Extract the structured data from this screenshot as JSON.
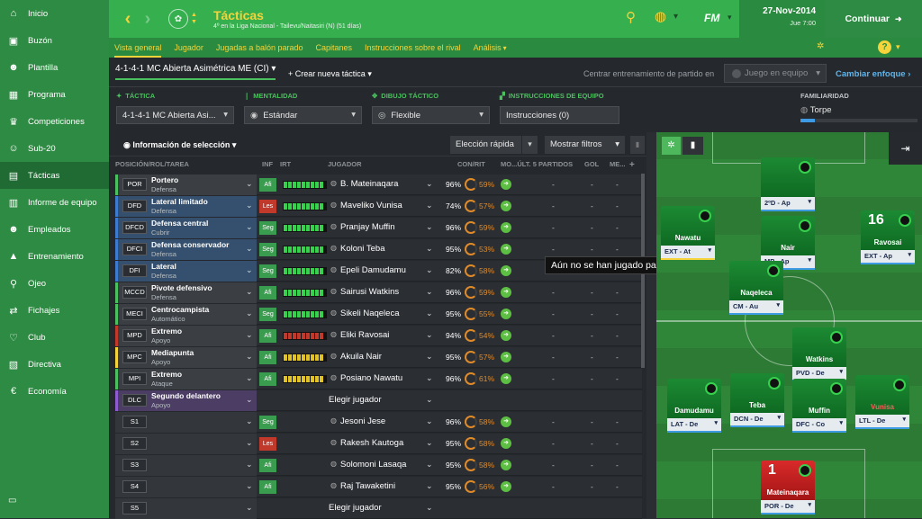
{
  "sidebar": {
    "items": [
      {
        "label": "Inicio",
        "icon": "home-icon"
      },
      {
        "label": "Buzón",
        "icon": "inbox-icon"
      },
      {
        "label": "Plantilla",
        "icon": "squad-icon"
      },
      {
        "label": "Programa",
        "icon": "calendar-icon"
      },
      {
        "label": "Competiciones",
        "icon": "trophy-icon"
      },
      {
        "label": "Sub-20",
        "icon": "youth-icon"
      },
      {
        "label": "Tácticas",
        "icon": "tactics-icon",
        "active": true
      },
      {
        "label": "Informe de equipo",
        "icon": "report-icon"
      },
      {
        "label": "Empleados",
        "icon": "staff-icon"
      },
      {
        "label": "Entrenamiento",
        "icon": "training-icon"
      },
      {
        "label": "Ojeo",
        "icon": "search-icon"
      },
      {
        "label": "Fichajes",
        "icon": "transfer-icon"
      },
      {
        "label": "Club",
        "icon": "club-icon"
      },
      {
        "label": "Directiva",
        "icon": "board-icon"
      },
      {
        "label": "Economía",
        "icon": "finance-icon"
      }
    ]
  },
  "header": {
    "title": "Tácticas",
    "subtitle": "4º en la Liga Nacional - Tailevu/Naitasiri (N) (51 días)",
    "logo_text": "FM",
    "date": "27-Nov-2014",
    "day_time": "Jue 7:00",
    "continue_label": "Continuar"
  },
  "nav": {
    "tabs": [
      "Vista general",
      "Jugador",
      "Jugadas a balón parado",
      "Capitanes",
      "Instrucciones sobre el rival",
      "Análisis"
    ]
  },
  "tactic_bar": {
    "tactic_name": "4-1-4-1 MC Abierta Asimétrica ME (CI)",
    "new_tactic": "Crear nueva táctica",
    "training_label": "Centrar entrenamiento de partido en",
    "training_value": "Juego en equipo",
    "change_focus": "Cambiar enfoque"
  },
  "settings": {
    "tactic_label": "TÁCTICA",
    "tactic_value": "4-1-4-1 MC Abierta Asi...",
    "mentality_label": "MENTALIDAD",
    "mentality_value": "Estándar",
    "shape_label": "DIBUJO TÁCTICO",
    "shape_value": "Flexible",
    "instructions_label": "INSTRUCCIONES DE EQUIPO",
    "instructions_value": "Instrucciones (0)",
    "familiarity_label": "FAMILIARIDAD",
    "familiarity_value": "Torpe",
    "familiarity_level": 0.12
  },
  "list": {
    "selection_info": "Información de selección",
    "quick_pick": "Elección rápida",
    "filters": "Mostrar filtros",
    "columns": {
      "pos": "POSICIÓN/ROL/TAREA",
      "inf": "INF",
      "irt": "IRT",
      "player": "JUGADOR",
      "cond": "CON/RIT",
      "mo": "MO...ÚLT. 5 PARTIDOS",
      "gol": "GOL",
      "me": "ME..."
    },
    "rows": [
      {
        "pos": "POR",
        "role": "Portero",
        "duty": "Defensa",
        "inf": "Afi",
        "player": "B. Mateinaqara",
        "cond": "96%",
        "rit": "59%",
        "stripe": "#4ac05f",
        "inf_color": "#3a9c4e",
        "irt_color": "#37d14e"
      },
      {
        "pos": "DFD",
        "role": "Lateral limitado",
        "duty": "Defensa",
        "inf": "Les",
        "player": "Maveliko Vunisa",
        "cond": "74%",
        "rit": "57%",
        "stripe": "#3d7bd1",
        "inf_color": "#c0392b",
        "irt_color": "#37d14e"
      },
      {
        "pos": "DFCD",
        "role": "Defensa central",
        "duty": "Cubrir",
        "inf": "Seg",
        "player": "Pranjay Muffin",
        "cond": "96%",
        "rit": "59%",
        "stripe": "#3d7bd1",
        "inf_color": "#3a9c4e",
        "irt_color": "#37d14e"
      },
      {
        "pos": "DFCI",
        "role": "Defensa conservador",
        "duty": "Defensa",
        "inf": "Seg",
        "player": "Koloni Teba",
        "cond": "95%",
        "rit": "53%",
        "stripe": "#3d7bd1",
        "inf_color": "#3a9c4e",
        "irt_color": "#37d14e"
      },
      {
        "pos": "DFI",
        "role": "Lateral",
        "duty": "Defensa",
        "inf": "Seg",
        "player": "Epeli Damudamu",
        "cond": "82%",
        "rit": "58%",
        "stripe": "#3d7bd1",
        "inf_color": "#3a9c4e",
        "irt_color": "#37d14e"
      },
      {
        "pos": "MCCD",
        "role": "Pivote defensivo",
        "duty": "Defensa",
        "inf": "Afi",
        "player": "Sairusi Watkins",
        "cond": "96%",
        "rit": "59%",
        "stripe": "#4ac05f",
        "inf_color": "#3a9c4e",
        "irt_color": "#37d14e"
      },
      {
        "pos": "MECI",
        "role": "Centrocampista",
        "duty": "Automático",
        "inf": "Seg",
        "player": "Sikeli Naqeleca",
        "cond": "95%",
        "rit": "55%",
        "stripe": "#4ac05f",
        "inf_color": "#3a9c4e",
        "irt_color": "#37d14e"
      },
      {
        "pos": "MPD",
        "role": "Extremo",
        "duty": "Apoyo",
        "inf": "Afi",
        "player": "Eliki Ravosai",
        "cond": "94%",
        "rit": "54%",
        "stripe": "#c0392b",
        "inf_color": "#3a9c4e",
        "irt_color": "#c0392b"
      },
      {
        "pos": "MPC",
        "role": "Mediapunta",
        "duty": "Apoyo",
        "inf": "Afi",
        "player": "Akuila Nair",
        "cond": "95%",
        "rit": "57%",
        "stripe": "#f4d33b",
        "inf_color": "#3a9c4e",
        "irt_color": "#e0c22b"
      },
      {
        "pos": "MPI",
        "role": "Extremo",
        "duty": "Ataque",
        "inf": "Afi",
        "player": "Posiano Nawatu",
        "cond": "96%",
        "rit": "61%",
        "stripe": "#4ac05f",
        "inf_color": "#3a9c4e",
        "irt_color": "#e0c22b"
      },
      {
        "pos": "DLC",
        "role": "Segundo delantero",
        "duty": "Apoyo",
        "inf": "",
        "player": "Elegir jugador",
        "cond": "",
        "rit": "",
        "stripe": "#8e5bd1",
        "inf_color": "",
        "irt_color": ""
      },
      {
        "pos": "S1",
        "role": "",
        "duty": "",
        "inf": "Seg",
        "player": "Jesoni Jese",
        "cond": "96%",
        "rit": "58%",
        "stripe": "",
        "inf_color": "#3a9c4e",
        "irt_color": ""
      },
      {
        "pos": "S2",
        "role": "",
        "duty": "",
        "inf": "Les",
        "player": "Rakesh Kautoga",
        "cond": "95%",
        "rit": "58%",
        "stripe": "",
        "inf_color": "#c0392b",
        "irt_color": ""
      },
      {
        "pos": "S3",
        "role": "",
        "duty": "",
        "inf": "Afi",
        "player": "Solomoni Lasaqa",
        "cond": "95%",
        "rit": "58%",
        "stripe": "",
        "inf_color": "#3a9c4e",
        "irt_color": ""
      },
      {
        "pos": "S4",
        "role": "",
        "duty": "",
        "inf": "Afi",
        "player": "Raj Tawaketini",
        "cond": "95%",
        "rit": "56%",
        "stripe": "",
        "inf_color": "#3a9c4e",
        "irt_color": ""
      },
      {
        "pos": "S5",
        "role": "",
        "duty": "",
        "inf": "",
        "player": "Elegir jugador",
        "cond": "",
        "rit": "",
        "stripe": "",
        "inf_color": "",
        "irt_color": ""
      }
    ],
    "dash": "-"
  },
  "tooltip": "Aún no se han jugado partidos",
  "pitch": {
    "cards": [
      {
        "name": "",
        "role": "2ºD - Ap",
        "num": "",
        "gk": false
      },
      {
        "name": "Nawatu",
        "role": "EXT - At",
        "num": "",
        "gk": false
      },
      {
        "name": "Nair",
        "role": "MP - Ap",
        "num": "",
        "gk": false
      },
      {
        "name": "Ravosai",
        "role": "EXT - Ap",
        "num": "16",
        "gk": false
      },
      {
        "name": "Naqeleca",
        "role": "CM - Au",
        "num": "",
        "gk": false
      },
      {
        "name": "Watkins",
        "role": "PVD - De",
        "num": "",
        "gk": false
      },
      {
        "name": "Damudamu",
        "role": "LAT - De",
        "num": "",
        "gk": false
      },
      {
        "name": "Teba",
        "role": "DCN - De",
        "num": "",
        "gk": false
      },
      {
        "name": "Muffin",
        "role": "DFC - Co",
        "num": "",
        "gk": false
      },
      {
        "name": "Vunisa",
        "role": "LTL - De",
        "num": "",
        "gk": false
      },
      {
        "name": "Mateinaqara",
        "role": "POR - De",
        "num": "1",
        "gk": true
      }
    ]
  }
}
